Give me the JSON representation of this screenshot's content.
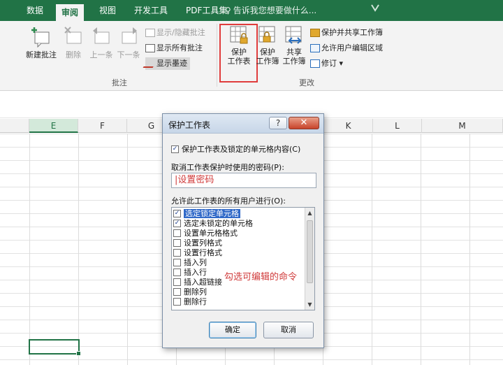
{
  "tabs": [
    "数据",
    "审阅",
    "视图",
    "开发工具",
    "PDF工具集"
  ],
  "active_tab": "审阅",
  "tell_me": "告诉我您想要做什么...",
  "ribbon": {
    "comments_group": {
      "label": "批注",
      "new_comment": "新建批注",
      "delete": "删除",
      "previous": "上一条",
      "next": "下一条",
      "show_hide": "显示/隐藏批注",
      "show_all": "显示所有批注",
      "show_ink": "显示墨迹"
    },
    "changes_group": {
      "label": "更改",
      "protect_sheet": [
        "保护",
        "工作表"
      ],
      "protect_workbook": [
        "保护",
        "工作簿"
      ],
      "share_workbook": [
        "共享",
        "工作簿"
      ],
      "protect_share": "保护并共享工作簿",
      "allow_edit_ranges": "允许用户编辑区域",
      "track_changes": "修订"
    }
  },
  "columns": [
    "E",
    "F",
    "G",
    "K",
    "L",
    "M"
  ],
  "dialog": {
    "title": "保护工作表",
    "help": "?",
    "close": "✕",
    "protect_check": "保护工作表及锁定的单元格内容(C)",
    "password_label": "取消工作表保护时使用的密码(P):",
    "password_value": "设置密码",
    "allow_label": "允许此工作表的所有用户进行(O):",
    "options": [
      {
        "label": "选定锁定单元格",
        "checked": true
      },
      {
        "label": "选定未锁定的单元格",
        "checked": true
      },
      {
        "label": "设置单元格格式",
        "checked": false
      },
      {
        "label": "设置列格式",
        "checked": false
      },
      {
        "label": "设置行格式",
        "checked": false
      },
      {
        "label": "插入列",
        "checked": false
      },
      {
        "label": "插入行",
        "checked": false
      },
      {
        "label": "插入超链接",
        "checked": false
      },
      {
        "label": "删除列",
        "checked": false
      },
      {
        "label": "删除行",
        "checked": false
      }
    ],
    "annotation": "勾选可编辑的命令",
    "ok": "确定",
    "cancel": "取消"
  },
  "colors": {
    "excel_green": "#217346",
    "highlight_red": "#e03c3c",
    "annotation_red": "#d03a3a",
    "list_selection": "#3069c8"
  }
}
